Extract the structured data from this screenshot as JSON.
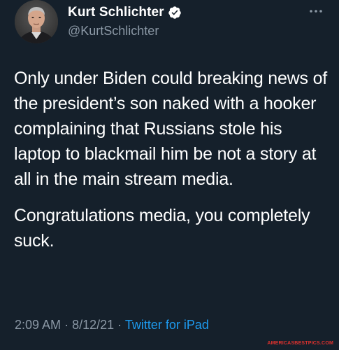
{
  "author": {
    "display_name": "Kurt Schlichter",
    "handle": "@KurtSchlichter",
    "verified": true
  },
  "menu_icon": "more-horizontal-icon",
  "tweet": {
    "paragraphs": [
      "Only under Biden could breaking news of the president’s son naked with a hooker complaining that Russians stole his laptop to blackmail him be not a story at all in the main stream media.",
      "Congratulations media, you completely suck."
    ],
    "time": "2:09 AM",
    "date": "8/12/21",
    "separator": "·",
    "source": "Twitter for iPad"
  },
  "watermark": "AMERICASBESTPICS.COM",
  "colors": {
    "background": "#15202b",
    "text": "#ffffff",
    "secondary_text": "#8b98a5",
    "link": "#1d9bf0",
    "verified_badge": "#ffffff"
  }
}
